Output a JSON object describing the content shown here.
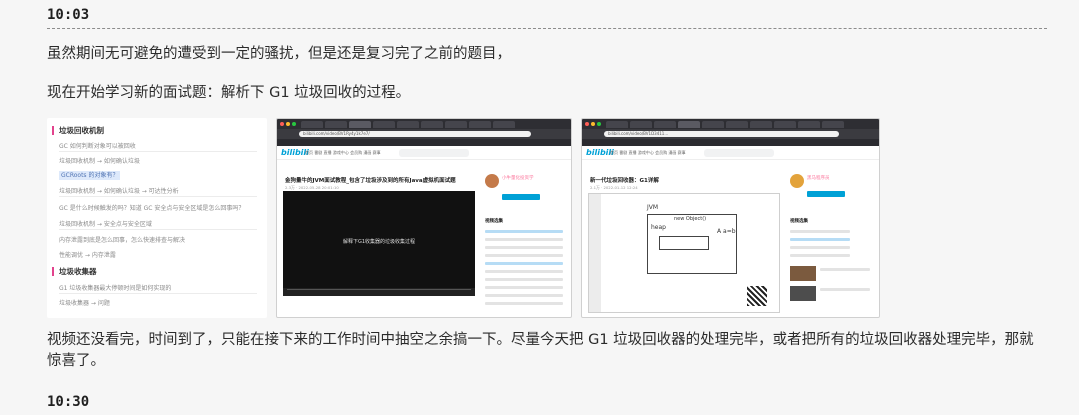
{
  "log": {
    "time_1": "10:03",
    "para_1": "虽然期间无可避免的遭受到一定的骚扰，但是还是复习完了之前的题目，",
    "para_2": "现在开始学习新的面试题：解析下 G1 垃圾回收的过程。",
    "para_3": "视频还没看完，时间到了，只能在接下来的工作时间中抽空之余搞一下。尽量今天把 G1 垃圾回收器的处理完毕，或者把所有的垃圾回收器处理完毕，那就惊喜了。",
    "time_2": "10:30"
  },
  "notes_panel": {
    "heading_1": "垃圾回收机制",
    "items_1": [
      "GC 如何判断对象可以被回收",
      "垃圾回收机制 → 如何确认垃圾",
      "GCRoots 的对象有？",
      "垃圾回收机制 → 如何确认垃圾 → 可达性分析",
      "GC 是什么时候触发的吗？知道 GC 安全点与安全区域是怎么回事吗？",
      "垃圾回收机制 → 安全点与安全区域",
      "内存泄露到底是怎么回事，怎么快速排查与解决",
      "性能调优 → 内存泄露"
    ],
    "heading_2": "垃圾收集器",
    "items_2": [
      "G1 垃圾收集器最大停顿时间是如何实现的",
      "垃圾收集器 → 问题"
    ]
  },
  "browser_1": {
    "url": "bilibili.com/video/BV1Ry4y1k7e7/",
    "logo": "bilibili",
    "nav": "首页 番剧 直播 游戏中心 会员购 漫画 赛事",
    "video_title": "金狗量牛的JVM面试教程_包含了垃圾涉及到的所有Java虚拟机面试题",
    "video_meta": "2.3万 · 2022-05-28 20:01:10",
    "player_text": "解释下G1收集器的垃圾收集过程",
    "uploader": "小牛量化投资学",
    "follow": "关注",
    "playlist_heading": "视频选集"
  },
  "browser_2": {
    "url": "bilibili.com/video/BV1D3411...",
    "logo": "bilibili",
    "nav": "首页 番剧 直播 游戏中心 会员购 漫画 赛事",
    "video_title": "新一代垃圾回收器：G1详解",
    "video_meta": "2.1万 · 2022-01-12 12:24",
    "uploader": "黑马程序员",
    "follow": "关注",
    "playlist_heading": "视频选集",
    "sketch_1": "JVM",
    "sketch_2": "heap",
    "sketch_3": "A a=b",
    "sketch_4": "new Object()"
  },
  "colors": {
    "accent": "#e2438d",
    "bili_blue": "#00a1d6",
    "highlight_bg": "#dde9fb",
    "page_bg": "#f6f6f6"
  }
}
